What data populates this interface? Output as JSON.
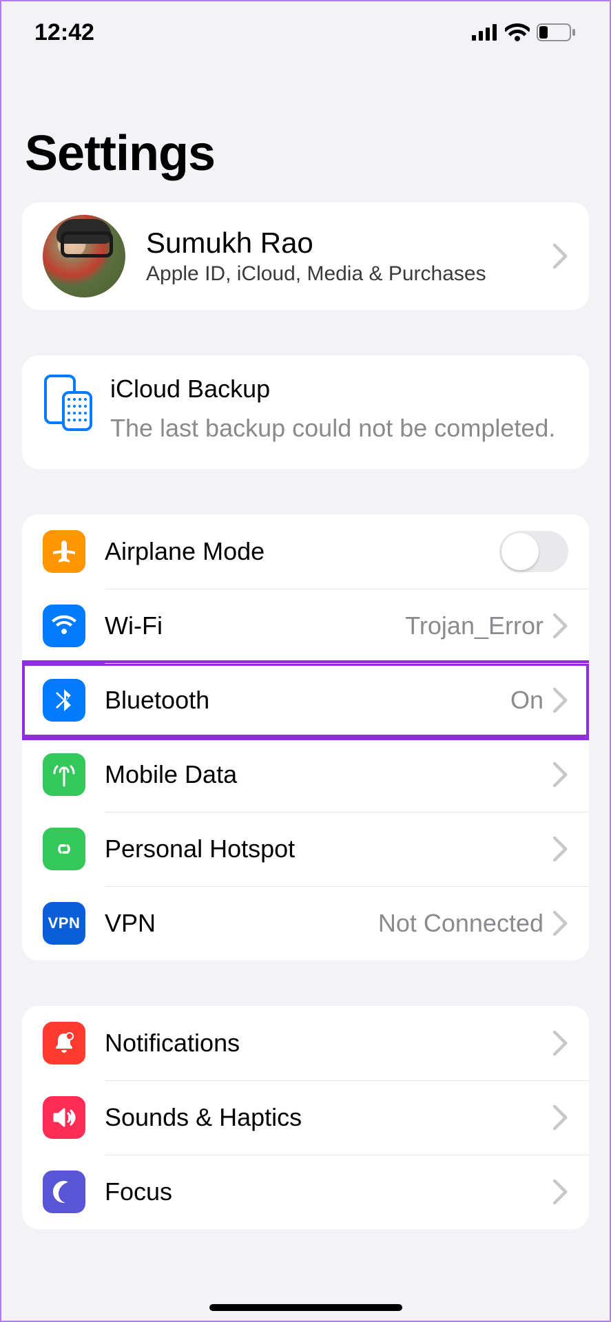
{
  "status": {
    "time": "12:42"
  },
  "page_title": "Settings",
  "profile": {
    "name": "Sumukh Rao",
    "subtitle": "Apple ID, iCloud, Media & Purchases"
  },
  "backup": {
    "title": "iCloud Backup",
    "message": "The last backup could not be completed."
  },
  "connectivity": {
    "airplane": {
      "label": "Airplane Mode"
    },
    "wifi": {
      "label": "Wi-Fi",
      "value": "Trojan_Error"
    },
    "bluetooth": {
      "label": "Bluetooth",
      "value": "On"
    },
    "mobile": {
      "label": "Mobile Data"
    },
    "hotspot": {
      "label": "Personal Hotspot"
    },
    "vpn": {
      "label": "VPN",
      "value": "Not Connected"
    }
  },
  "notifications_group": {
    "notifications": {
      "label": "Notifications"
    },
    "sounds": {
      "label": "Sounds & Haptics"
    },
    "focus": {
      "label": "Focus"
    }
  }
}
